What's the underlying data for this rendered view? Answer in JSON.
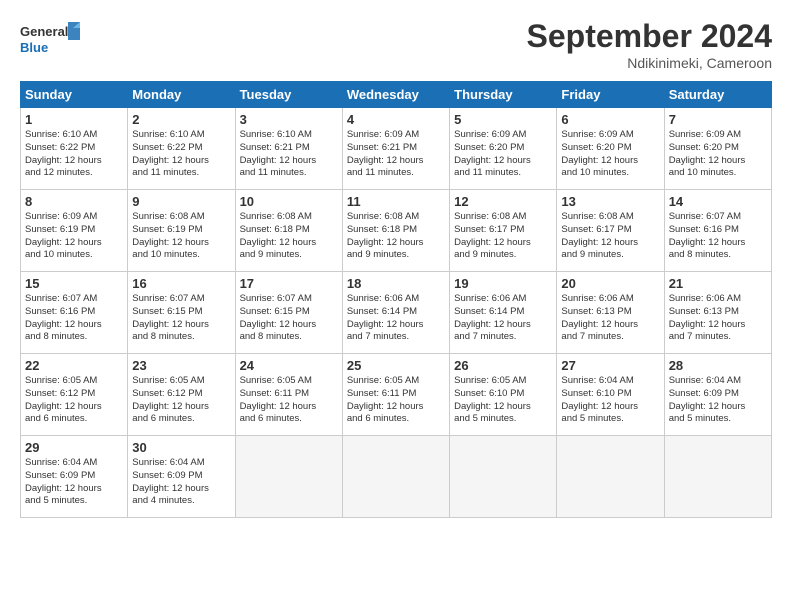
{
  "header": {
    "logo_line1": "General",
    "logo_line2": "Blue",
    "month": "September 2024",
    "location": "Ndikinimeki, Cameroon"
  },
  "weekdays": [
    "Sunday",
    "Monday",
    "Tuesday",
    "Wednesday",
    "Thursday",
    "Friday",
    "Saturday"
  ],
  "weeks": [
    [
      {
        "day": "1",
        "info": "Sunrise: 6:10 AM\nSunset: 6:22 PM\nDaylight: 12 hours\nand 12 minutes."
      },
      {
        "day": "2",
        "info": "Sunrise: 6:10 AM\nSunset: 6:22 PM\nDaylight: 12 hours\nand 11 minutes."
      },
      {
        "day": "3",
        "info": "Sunrise: 6:10 AM\nSunset: 6:21 PM\nDaylight: 12 hours\nand 11 minutes."
      },
      {
        "day": "4",
        "info": "Sunrise: 6:09 AM\nSunset: 6:21 PM\nDaylight: 12 hours\nand 11 minutes."
      },
      {
        "day": "5",
        "info": "Sunrise: 6:09 AM\nSunset: 6:20 PM\nDaylight: 12 hours\nand 11 minutes."
      },
      {
        "day": "6",
        "info": "Sunrise: 6:09 AM\nSunset: 6:20 PM\nDaylight: 12 hours\nand 10 minutes."
      },
      {
        "day": "7",
        "info": "Sunrise: 6:09 AM\nSunset: 6:20 PM\nDaylight: 12 hours\nand 10 minutes."
      }
    ],
    [
      {
        "day": "8",
        "info": "Sunrise: 6:09 AM\nSunset: 6:19 PM\nDaylight: 12 hours\nand 10 minutes."
      },
      {
        "day": "9",
        "info": "Sunrise: 6:08 AM\nSunset: 6:19 PM\nDaylight: 12 hours\nand 10 minutes."
      },
      {
        "day": "10",
        "info": "Sunrise: 6:08 AM\nSunset: 6:18 PM\nDaylight: 12 hours\nand 9 minutes."
      },
      {
        "day": "11",
        "info": "Sunrise: 6:08 AM\nSunset: 6:18 PM\nDaylight: 12 hours\nand 9 minutes."
      },
      {
        "day": "12",
        "info": "Sunrise: 6:08 AM\nSunset: 6:17 PM\nDaylight: 12 hours\nand 9 minutes."
      },
      {
        "day": "13",
        "info": "Sunrise: 6:08 AM\nSunset: 6:17 PM\nDaylight: 12 hours\nand 9 minutes."
      },
      {
        "day": "14",
        "info": "Sunrise: 6:07 AM\nSunset: 6:16 PM\nDaylight: 12 hours\nand 8 minutes."
      }
    ],
    [
      {
        "day": "15",
        "info": "Sunrise: 6:07 AM\nSunset: 6:16 PM\nDaylight: 12 hours\nand 8 minutes."
      },
      {
        "day": "16",
        "info": "Sunrise: 6:07 AM\nSunset: 6:15 PM\nDaylight: 12 hours\nand 8 minutes."
      },
      {
        "day": "17",
        "info": "Sunrise: 6:07 AM\nSunset: 6:15 PM\nDaylight: 12 hours\nand 8 minutes."
      },
      {
        "day": "18",
        "info": "Sunrise: 6:06 AM\nSunset: 6:14 PM\nDaylight: 12 hours\nand 7 minutes."
      },
      {
        "day": "19",
        "info": "Sunrise: 6:06 AM\nSunset: 6:14 PM\nDaylight: 12 hours\nand 7 minutes."
      },
      {
        "day": "20",
        "info": "Sunrise: 6:06 AM\nSunset: 6:13 PM\nDaylight: 12 hours\nand 7 minutes."
      },
      {
        "day": "21",
        "info": "Sunrise: 6:06 AM\nSunset: 6:13 PM\nDaylight: 12 hours\nand 7 minutes."
      }
    ],
    [
      {
        "day": "22",
        "info": "Sunrise: 6:05 AM\nSunset: 6:12 PM\nDaylight: 12 hours\nand 6 minutes."
      },
      {
        "day": "23",
        "info": "Sunrise: 6:05 AM\nSunset: 6:12 PM\nDaylight: 12 hours\nand 6 minutes."
      },
      {
        "day": "24",
        "info": "Sunrise: 6:05 AM\nSunset: 6:11 PM\nDaylight: 12 hours\nand 6 minutes."
      },
      {
        "day": "25",
        "info": "Sunrise: 6:05 AM\nSunset: 6:11 PM\nDaylight: 12 hours\nand 6 minutes."
      },
      {
        "day": "26",
        "info": "Sunrise: 6:05 AM\nSunset: 6:10 PM\nDaylight: 12 hours\nand 5 minutes."
      },
      {
        "day": "27",
        "info": "Sunrise: 6:04 AM\nSunset: 6:10 PM\nDaylight: 12 hours\nand 5 minutes."
      },
      {
        "day": "28",
        "info": "Sunrise: 6:04 AM\nSunset: 6:09 PM\nDaylight: 12 hours\nand 5 minutes."
      }
    ],
    [
      {
        "day": "29",
        "info": "Sunrise: 6:04 AM\nSunset: 6:09 PM\nDaylight: 12 hours\nand 5 minutes."
      },
      {
        "day": "30",
        "info": "Sunrise: 6:04 AM\nSunset: 6:09 PM\nDaylight: 12 hours\nand 4 minutes."
      },
      {
        "day": "",
        "info": ""
      },
      {
        "day": "",
        "info": ""
      },
      {
        "day": "",
        "info": ""
      },
      {
        "day": "",
        "info": ""
      },
      {
        "day": "",
        "info": ""
      }
    ]
  ]
}
